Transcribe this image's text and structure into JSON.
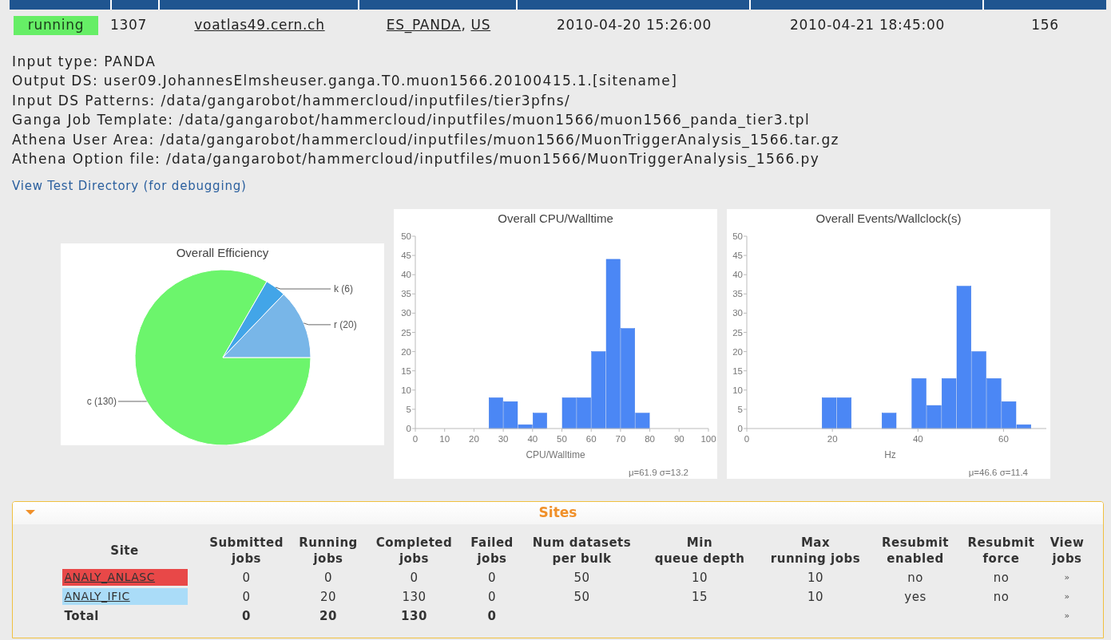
{
  "job_row": {
    "status": "running",
    "id": "1307",
    "host": "voatlas49.cern.ch",
    "sites": [
      "ES_PANDA",
      "US"
    ],
    "site_separator": ",",
    "start": "2010-04-20 15:26:00",
    "end": "2010-04-21 18:45:00",
    "count": "156"
  },
  "details": [
    "Input type: PANDA",
    "Output DS: user09.JohannesElmsheuser.ganga.T0.muon1566.20100415.1.[sitename]",
    "Input DS Patterns: /data/gangarobot/hammercloud/inputfiles/tier3pfns/",
    "Ganga Job Template: /data/gangarobot/hammercloud/inputfiles/muon1566/muon1566_panda_tier3.tpl",
    "Athena User Area: /data/gangarobot/hammercloud/inputfiles/muon1566/MuonTriggerAnalysis_1566.tar.gz",
    "Athena Option file: /data/gangarobot/hammercloud/inputfiles/muon1566/MuonTriggerAnalysis_1566.py"
  ],
  "debug_link": "View Test Directory (for debugging)",
  "charts": [
    {
      "chart_data": {
        "type": "pie",
        "title": "Overall Efficiency",
        "categories": [
          "c (130)",
          "k (6)",
          "r (20)"
        ],
        "values": [
          130,
          6,
          20
        ],
        "colors": [
          "#6cf56c",
          "#42a5e8",
          "#78b6e8"
        ]
      }
    },
    {
      "chart_data": {
        "type": "bar",
        "title": "Overall CPU/Walltime",
        "xlabel": "CPU/Walltime",
        "x": [
          27.5,
          32.5,
          37.5,
          42.5,
          52.5,
          57.5,
          62.5,
          67.5,
          72.5,
          77.5
        ],
        "values": [
          8,
          7,
          1,
          4,
          8,
          8,
          20,
          44,
          26,
          4
        ],
        "xlim": [
          0,
          100
        ],
        "ylim": [
          0,
          50
        ],
        "xticks": [
          0,
          10,
          20,
          30,
          40,
          50,
          60,
          70,
          80,
          90,
          100
        ],
        "yticks": [
          0,
          5,
          10,
          15,
          20,
          25,
          30,
          35,
          40,
          45,
          50
        ]
      },
      "stats": "μ=61.9 σ=13.2"
    },
    {
      "chart_data": {
        "type": "bar",
        "title": "Overall Events/Wallclock(s)",
        "xlabel": "Hz",
        "x": [
          19.25,
          22.75,
          33.25,
          40.25,
          43.75,
          47.25,
          50.75,
          54.25,
          57.75,
          61.25,
          64.75
        ],
        "values": [
          8,
          8,
          4,
          13,
          6,
          13,
          37,
          20,
          13,
          7,
          1
        ],
        "xlim": [
          0,
          70
        ],
        "ylim": [
          0,
          50
        ],
        "xticks": [
          0,
          20,
          40,
          60
        ],
        "yticks": [
          0,
          5,
          10,
          15,
          20,
          25,
          30,
          35,
          40,
          45,
          50
        ]
      },
      "stats": "μ=46.6 σ=11.4"
    }
  ],
  "sites_panel": {
    "title": "Sites",
    "expanded": true,
    "columns": [
      "Site",
      "Submitted\njobs",
      "Running\njobs",
      "Completed\njobs",
      "Failed\njobs",
      "Num datasets\nper bulk",
      "Min\nqueue depth",
      "Max\nrunning jobs",
      "Resubmit\nenabled",
      "Resubmit\nforce",
      "View\njobs"
    ],
    "rows": [
      {
        "color": "#e84848",
        "cells": [
          "ANALY_ANLASC",
          "0",
          "0",
          "0",
          "0",
          "50",
          "10",
          "10",
          "no",
          "no",
          "»"
        ]
      },
      {
        "color": "#aadcf8",
        "cells": [
          "ANALY_IFIC",
          "0",
          "20",
          "130",
          "0",
          "50",
          "15",
          "10",
          "yes",
          "no",
          "»"
        ]
      },
      {
        "kind": "total",
        "cells": [
          "Total",
          "0",
          "20",
          "130",
          "0",
          "",
          "",
          "",
          "",
          "",
          "»"
        ]
      }
    ]
  }
}
